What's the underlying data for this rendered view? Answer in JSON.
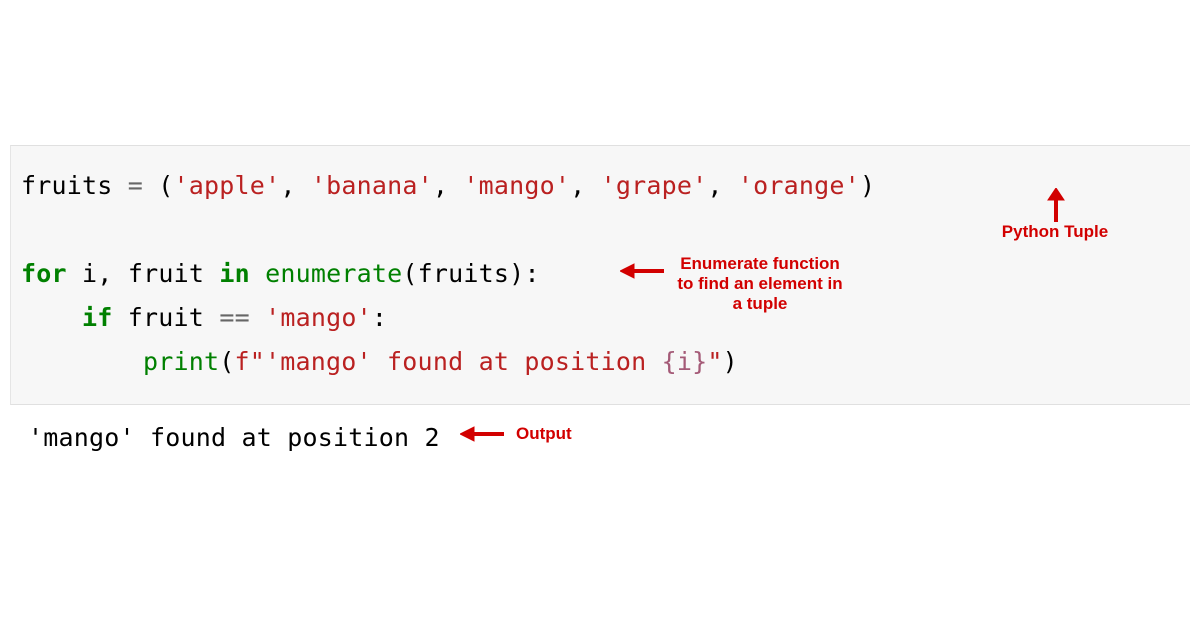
{
  "code": {
    "line1": {
      "var": "fruits",
      "eq": " = ",
      "lpar": "(",
      "s1": "'apple'",
      "c1": ", ",
      "s2": "'banana'",
      "c2": ", ",
      "s3": "'mango'",
      "c3": ", ",
      "s4": "'grape'",
      "c4": ", ",
      "s5": "'orange'",
      "rpar": ")"
    },
    "line3": {
      "for_kw": "for",
      "sp1": " ",
      "i": "i",
      "comma": ", ",
      "fruit": "fruit",
      "sp2": " ",
      "in_kw": "in",
      "sp3": " ",
      "enumer": "enumerate",
      "lpar": "(",
      "arg": "fruits",
      "rpar": ")",
      "colon": ":"
    },
    "line4": {
      "indent": "    ",
      "if_kw": "if",
      "sp1": " ",
      "fruit": "fruit",
      "sp2": " ",
      "eqeq": "==",
      "sp3": " ",
      "mango": "'mango'",
      "colon": ":"
    },
    "line5": {
      "indent": "        ",
      "print": "print",
      "lpar": "(",
      "fstr_a": "f\"'mango' found at position ",
      "interp": "{i}",
      "fstr_b": "\"",
      "rpar": ")"
    }
  },
  "output": {
    "text": "'mango' found at position 2"
  },
  "annotations": {
    "tuple": "Python Tuple",
    "enum_l1": "Enumerate function",
    "enum_l2": "to find an element in",
    "enum_l3": "a tuple",
    "output": "Output"
  }
}
